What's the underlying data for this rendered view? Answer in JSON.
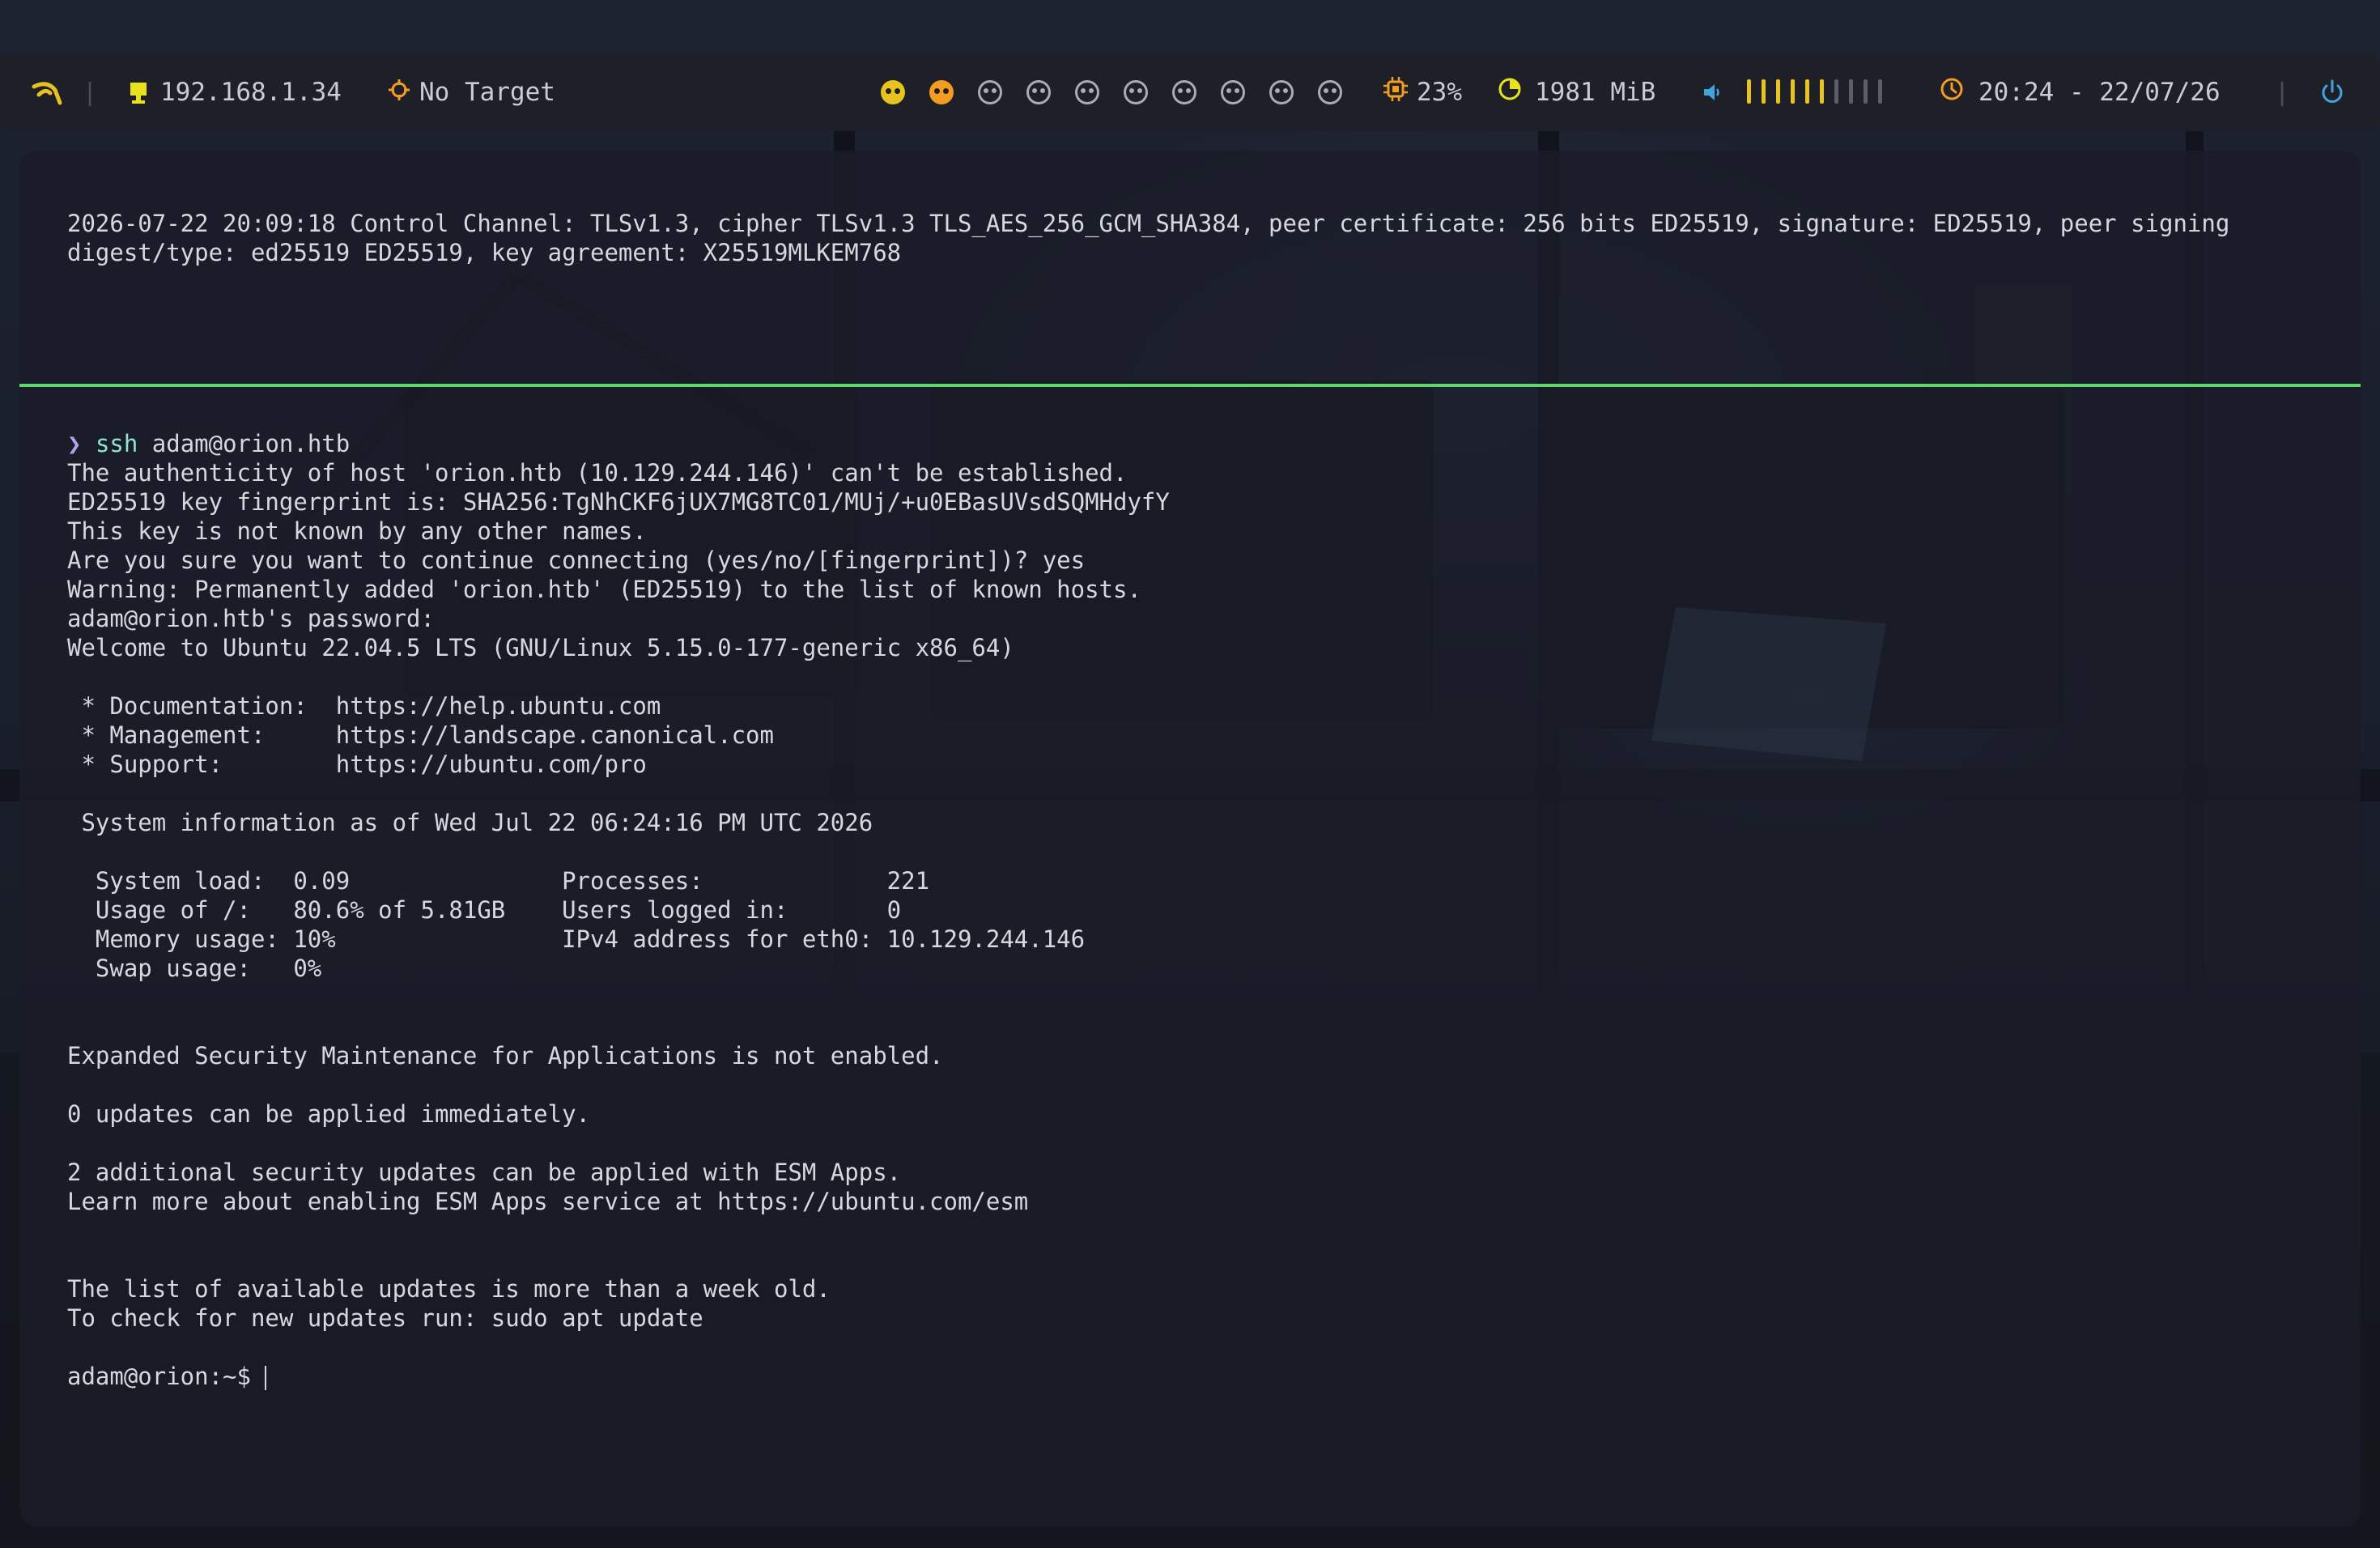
{
  "bar": {
    "logo_icon": "hacker-logo-icon",
    "ip_icon": "monitor-icon",
    "ip_address": "192.168.1.34",
    "target_icon": "crosshair-icon",
    "target": "No Target",
    "workspaces": [
      {
        "state": "active",
        "color": "#e8c21e"
      },
      {
        "state": "active",
        "color": "#f39c22"
      },
      {
        "state": "idle"
      },
      {
        "state": "idle"
      },
      {
        "state": "idle"
      },
      {
        "state": "idle"
      },
      {
        "state": "idle"
      },
      {
        "state": "idle"
      },
      {
        "state": "idle"
      },
      {
        "state": "idle"
      }
    ],
    "cpu_icon": "cpu-icon",
    "cpu": "23%",
    "memory_icon": "memory-pie-icon",
    "memory": "1981 MiB",
    "volume_icon": "speaker-icon",
    "volume_level": 0.6,
    "clock_icon": "clock-icon",
    "datetime": "20:24 - 22/07/26",
    "power_icon": "power-icon",
    "accent_colors": {
      "yellow": "#e8c21e",
      "orange": "#f39c22",
      "blue": "#3fa4e0",
      "green": "#5fd86a"
    }
  },
  "terminal": {
    "top_lines": [
      "2026-07-22 20:09:18 Control Channel: TLSv1.3, cipher TLSv1.3 TLS_AES_256_GCM_SHA384, peer certificate: 256 bits ED25519, signature: ED25519, peer signing",
      "digest/type: ed25519 ED25519, key agreement: X25519MLKEM768"
    ],
    "prompt_symbol": "❯",
    "command_name": "ssh",
    "command_args": " adam@orion.htb",
    "lines": [
      "The authenticity of host 'orion.htb (10.129.244.146)' can't be established.",
      "ED25519 key fingerprint is: SHA256:TgNhCKF6jUX7MG8TC01/MUj/+u0EBasUVsdSQMHdyfY",
      "This key is not known by any other names.",
      "Are you sure you want to continue connecting (yes/no/[fingerprint])? yes",
      "Warning: Permanently added 'orion.htb' (ED25519) to the list of known hosts.",
      "adam@orion.htb's password:",
      "Welcome to Ubuntu 22.04.5 LTS (GNU/Linux 5.15.0-177-generic x86_64)",
      "",
      " * Documentation:  https://help.ubuntu.com",
      " * Management:     https://landscape.canonical.com",
      " * Support:        https://ubuntu.com/pro",
      "",
      " System information as of Wed Jul 22 06:24:16 PM UTC 2026",
      "",
      "  System load:  0.09               Processes:             221",
      "  Usage of /:   80.6% of 5.81GB    Users logged in:       0",
      "  Memory usage: 10%                IPv4 address for eth0: 10.129.244.146",
      "  Swap usage:   0%",
      "",
      "",
      "Expanded Security Maintenance for Applications is not enabled.",
      "",
      "0 updates can be applied immediately.",
      "",
      "2 additional security updates can be applied with ESM Apps.",
      "Learn more about enabling ESM Apps service at https://ubuntu.com/esm",
      "",
      "",
      "The list of available updates is more than a week old.",
      "To check for new updates run: sudo apt update",
      "",
      "adam@orion:~$ "
    ]
  }
}
